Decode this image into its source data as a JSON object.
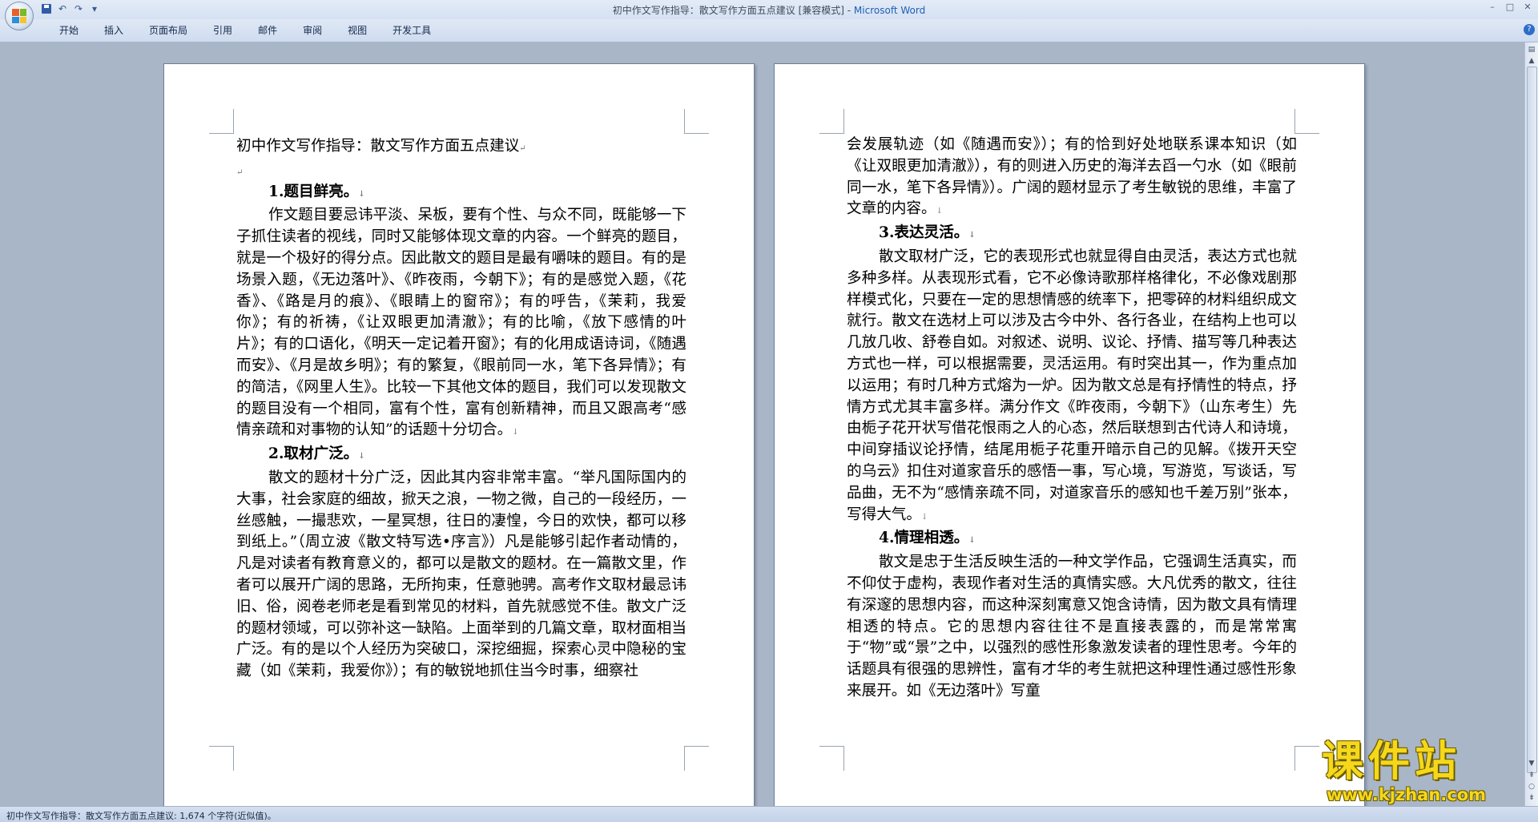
{
  "window": {
    "title_doc": "初中作文写作指导：散文写作方面五点建议 [兼容模式] - ",
    "title_app": "Microsoft Word"
  },
  "quick_access": {
    "save_icon": "save-icon",
    "undo_icon": "undo-icon",
    "redo_icon": "redo-icon"
  },
  "ribbon": {
    "tabs": [
      "开始",
      "插入",
      "页面布局",
      "引用",
      "邮件",
      "审阅",
      "视图",
      "开发工具"
    ]
  },
  "document": {
    "left_page": {
      "title": "初中作文写作指导：散文写作方面五点建议",
      "heading1": "1.题目鲜亮。",
      "para1": "作文题目要忌讳平淡、呆板，要有个性、与众不同，既能够一下子抓住读者的视线，同时又能够体现文章的内容。一个鲜亮的题目，就是一个极好的得分点。因此散文的题目是最有嚼味的题目。有的是场景入题，《无边落叶》、《昨夜雨，今朝下》；有的是感觉入题，《花香》、《路是月的痕》、《眼睛上的窗帘》；有的呼告，《茉莉，我爱你》；有的祈祷，《让双眼更加清澈》；有的比喻，《放下感情的叶片》；有的口语化，《明天一定记着开窗》；有的化用成语诗词，《随遇而安》、《月是故乡明》；有的繁复，《眼前同一水，笔下各异情》；有的简洁，《网里人生》。比较一下其他文体的题目，我们可以发现散文的题目没有一个相同，富有个性，富有创新精神，而且又跟高考“感情亲疏和对事物的认知”的话题十分切合。",
      "heading2": "2.取材广泛。",
      "para2": "散文的题材十分广泛，因此其内容非常丰富。“举凡国际国内的大事，社会家庭的细故，掀天之浪，一物之微，自己的一段经历，一丝感触，一撮悲欢，一星冥想，往日的凄惶，今日的欢快，都可以移到纸上。”（周立波《散文特写选•序言》）凡是能够引起作者动情的，凡是对读者有教育意义的，都可以是散文的题材。在一篇散文里，作者可以展开广阔的思路，无所拘束，任意驰骋。高考作文取材最忌讳旧、俗，阅卷老师老是看到常见的材料，首先就感觉不佳。散文广泛的题材领域，可以弥补这一缺陷。上面举到的几篇文章，取材面相当广泛。有的是以个人经历为突破口，深挖细掘，探索心灵中隐秘的宝藏（如《茉莉，我爱你》）；有的敏锐地抓住当今时事，细察社"
    },
    "right_page": {
      "para2_cont": "会发展轨迹（如《随遇而安》）；有的恰到好处地联系课本知识（如《让双眼更加清澈》），有的则进入历史的海洋去舀一勺水（如《眼前同一水，笔下各异情》）。广阔的题材显示了考生敏锐的思维，丰富了文章的内容。",
      "heading3": "3.表达灵活。",
      "para3": "散文取材广泛，它的表现形式也就显得自由灵活，表达方式也就多种多样。从表现形式看，它不必像诗歌那样格律化，不必像戏剧那样模式化，只要在一定的思想情感的统率下，把零碎的材料组织成文就行。散文在选材上可以涉及古今中外、各行各业，在结构上也可以几放几收、舒卷自如。对叙述、说明、议论、抒情、描写等几种表达方式也一样，可以根据需要，灵活运用。有时突出其一，作为重点加以运用；有时几种方式熔为一炉。因为散文总是有抒情性的特点，抒情方式尤其丰富多样。满分作文《昨夜雨，今朝下》（山东考生）先由栀子花开状写借花恨雨之人的心态，然后联想到古代诗人和诗境，中间穿插议论抒情，结尾用栀子花重开暗示自己的见解。《拨开天空的乌云》扣住对道家音乐的感悟一事，写心境，写游览，写谈话，写品曲，无不为“感情亲疏不同，对道家音乐的感知也千差万别”张本，写得大气。",
      "heading4": "4.情理相透。",
      "para4": "散文是忠于生活反映生活的一种文学作品，它强调生活真实，而不仰仗于虚构，表现作者对生活的真情实感。大凡优秀的散文，往往有深邃的思想内容，而这种深刻寓意又饱含诗情，因为散文具有情理相透的特点。它的思想内容往往不是直接表露的，而是常常寓于“物”或“景”之中，以强烈的感性形象激发读者的理性思考。今年的话题具有很强的思辨性，富有才华的考生就把这种理性通过感性形象来展开。如《无边落叶》写童"
    }
  },
  "status": {
    "text": "初中作文写作指导：散文写作方面五点建议: 1,674 个字符(近似值)。"
  },
  "watermark": {
    "main": "课件站",
    "url": "www.kjzhan.com"
  }
}
